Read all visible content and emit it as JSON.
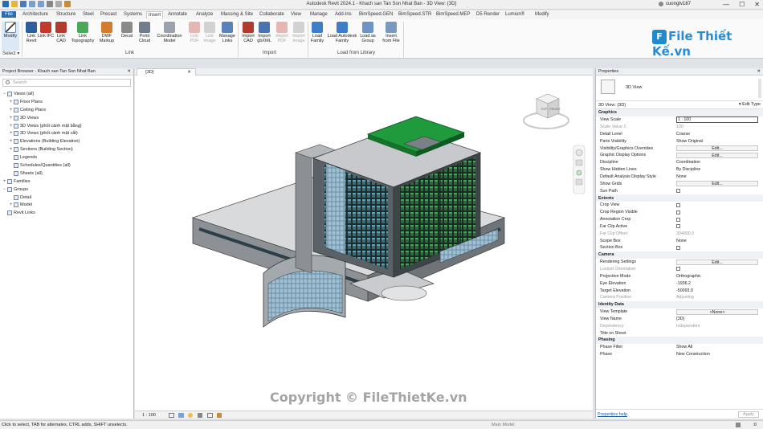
{
  "titlebar": {
    "title": "Autodesk Revit 2024.1 - Khach san Tan Son Nhat Ban - 3D View: {3D}",
    "user": "cuongtv187",
    "minimize": "—",
    "maximize": "☐",
    "close": "✕"
  },
  "menu": {
    "tabs": [
      "File",
      "Architecture",
      "Structure",
      "Steel",
      "Precast",
      "Systems",
      "Insert",
      "Annotate",
      "Analyze",
      "Massing & Site",
      "Collaborate",
      "View",
      "Manage",
      "Add-Ins",
      "BimSpeed.GEN",
      "BimSpeed.STR",
      "BimSpeed.MEP",
      "D5 Render",
      "Lumion®",
      "Modify"
    ],
    "active": "Insert"
  },
  "ribbon": {
    "select": {
      "modify": "Modify",
      "group": "Select ▾"
    },
    "link": {
      "buttons": [
        "Link Revit",
        "Link IFC",
        "Link CAD",
        "Link Topography",
        "DWF Markup",
        "Decal",
        "Point Cloud",
        "Coordination Model",
        "Link PDF",
        "Link Image",
        "Manage Links"
      ],
      "disabled": [
        false,
        false,
        false,
        false,
        false,
        false,
        false,
        false,
        true,
        true,
        false
      ],
      "group": "Link"
    },
    "import": {
      "buttons": [
        "Import CAD",
        "Import gbXML",
        "Import PDF",
        "Import Image"
      ],
      "disabled": [
        false,
        false,
        true,
        true
      ],
      "group": "Import"
    },
    "load": {
      "buttons": [
        "Load Family",
        "Load Autodesk Family",
        "Load as Group",
        "Insert from File"
      ],
      "group": "Load from Library"
    }
  },
  "logo": {
    "mark": "F",
    "text": "File Thiết Kế.vn"
  },
  "project_browser": {
    "title": "Project Browser - Khach san Tan Son Nhat Ban",
    "close": "✕",
    "search_placeholder": "Search",
    "items": [
      {
        "toggle": "−",
        "label": "Views (all)",
        "indent": 0
      },
      {
        "toggle": "+",
        "label": "Floor Plans",
        "indent": 1
      },
      {
        "toggle": "+",
        "label": "Ceiling Plans",
        "indent": 1
      },
      {
        "toggle": "+",
        "label": "3D Views",
        "indent": 1
      },
      {
        "toggle": "+",
        "label": "3D Views (phối cảnh mặt bằng)",
        "indent": 1
      },
      {
        "toggle": "+",
        "label": "3D Views (phối cảnh mặt cắt)",
        "indent": 1
      },
      {
        "toggle": "+",
        "label": "Elevations (Building Elevation)",
        "indent": 1
      },
      {
        "toggle": "+",
        "label": "Sections (Building Section)",
        "indent": 1
      },
      {
        "toggle": "",
        "label": "Legends",
        "indent": 1
      },
      {
        "toggle": "",
        "label": "Schedules/Quantities (all)",
        "indent": 1
      },
      {
        "toggle": "",
        "label": "Sheets (all)",
        "indent": 1
      },
      {
        "toggle": "+",
        "label": "Families",
        "indent": 0
      },
      {
        "toggle": "−",
        "label": "Groups",
        "indent": 0
      },
      {
        "toggle": "",
        "label": "Detail",
        "indent": 1
      },
      {
        "toggle": "+",
        "label": "Model",
        "indent": 1
      },
      {
        "toggle": "",
        "label": "Revit Links",
        "indent": 0
      }
    ]
  },
  "viewport": {
    "tab": "{3D}",
    "tab_close": "✕",
    "scale": "1 : 100",
    "viewcube": {
      "top": "TOP",
      "front": "FRONT"
    }
  },
  "properties": {
    "title": "Properties",
    "close": "✕",
    "type_name": "3D View",
    "filter": "3D View: {3D}",
    "edit_type": "Edit Type",
    "rows": [
      {
        "kind": "sec",
        "k": "Graphics"
      },
      {
        "kind": "input",
        "k": "View Scale",
        "v": "1 : 100"
      },
      {
        "kind": "ro",
        "k": "Scale Value    1:",
        "v": "100"
      },
      {
        "kind": "text",
        "k": "Detail Level",
        "v": "Coarse"
      },
      {
        "kind": "text",
        "k": "Parts Visibility",
        "v": "Show Original"
      },
      {
        "kind": "btn",
        "k": "Visibility/Graphics Overrides",
        "v": "Edit..."
      },
      {
        "kind": "btn",
        "k": "Graphic Display Options",
        "v": "Edit..."
      },
      {
        "kind": "text",
        "k": "Discipline",
        "v": "Coordination"
      },
      {
        "kind": "text",
        "k": "Show Hidden Lines",
        "v": "By Discipline"
      },
      {
        "kind": "text",
        "k": "Default Analysis Display Style",
        "v": "None"
      },
      {
        "kind": "btn",
        "k": "Show Grids",
        "v": "Edit..."
      },
      {
        "kind": "chk",
        "k": "Sun Path",
        "v": ""
      },
      {
        "kind": "sec",
        "k": "Extents"
      },
      {
        "kind": "chk",
        "k": "Crop View",
        "v": ""
      },
      {
        "kind": "chk",
        "k": "Crop Region Visible",
        "v": ""
      },
      {
        "kind": "chk",
        "k": "Annotation Crop",
        "v": ""
      },
      {
        "kind": "chk",
        "k": "Far Clip Active",
        "v": ""
      },
      {
        "kind": "ro",
        "k": "Far Clip Offset",
        "v": "304800.0"
      },
      {
        "kind": "text",
        "k": "Scope Box",
        "v": "None"
      },
      {
        "kind": "chk",
        "k": "Section Box",
        "v": ""
      },
      {
        "kind": "sec",
        "k": "Camera"
      },
      {
        "kind": "btn",
        "k": "Rendering Settings",
        "v": "Edit..."
      },
      {
        "kind": "rochk",
        "k": "Locked Orientation",
        "v": ""
      },
      {
        "kind": "text",
        "k": "Projection Mode",
        "v": "Orthographic"
      },
      {
        "kind": "text",
        "k": "Eye Elevation",
        "v": "-1936.2"
      },
      {
        "kind": "text",
        "k": "Target Elevation",
        "v": "-50093.0"
      },
      {
        "kind": "ro",
        "k": "Camera Position",
        "v": "Adjusting"
      },
      {
        "kind": "sec",
        "k": "Identity Data"
      },
      {
        "kind": "btn",
        "k": "View Template",
        "v": "<None>"
      },
      {
        "kind": "text",
        "k": "View Name",
        "v": "{3D}"
      },
      {
        "kind": "ro",
        "k": "Dependency",
        "v": "Independent"
      },
      {
        "kind": "text",
        "k": "Title on Sheet",
        "v": ""
      },
      {
        "kind": "sec",
        "k": "Phasing"
      },
      {
        "kind": "text",
        "k": "Phase Filter",
        "v": "Show All"
      },
      {
        "kind": "text",
        "k": "Phase",
        "v": "New Construction"
      }
    ],
    "help": "Properties help",
    "apply": "Apply"
  },
  "statusbar": {
    "message": "Click to select, TAB for alternates, CTRL adds, SHIFT unselects.",
    "model": "Main Model",
    "filter_count": ":0"
  },
  "watermark": "Copyright © FileThietKe.vn",
  "colors": {
    "file_tab": "#2a6db3",
    "accent": "#1f8ad0",
    "roof_green": "#1f9a3c"
  }
}
